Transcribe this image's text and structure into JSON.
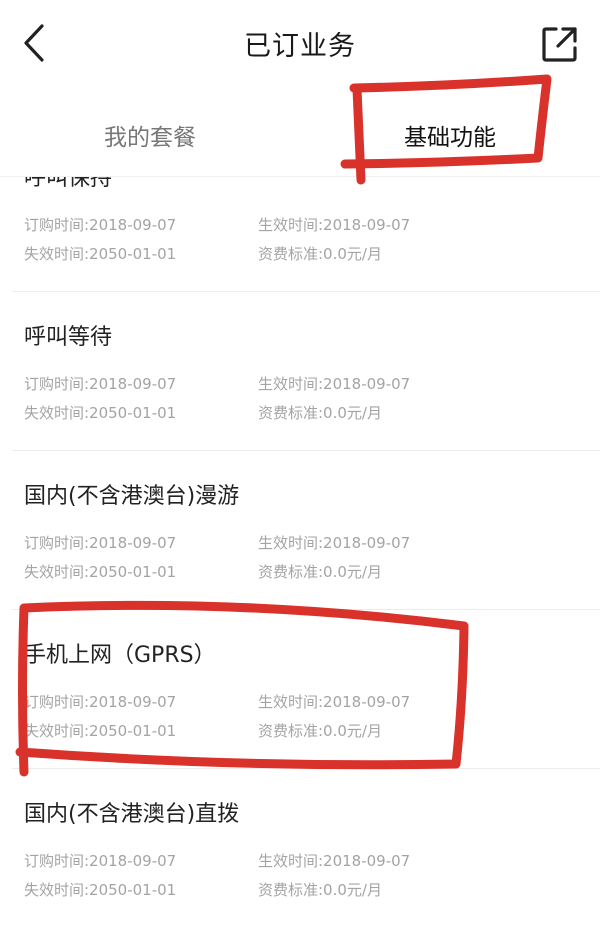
{
  "header": {
    "title": "已订业务",
    "back_icon": "chevron-left-icon",
    "share_icon": "external-link-icon"
  },
  "tabs": [
    {
      "label": "我的套餐",
      "active": false
    },
    {
      "label": "基础功能",
      "active": true
    }
  ],
  "labels": {
    "order_time": "订购时间:",
    "effective_time": "生效时间:",
    "expire_time": "失效时间:",
    "tariff": "资费标准:"
  },
  "services": [
    {
      "name": "呼叫保持",
      "order_time": "订购时间:2018-09-07",
      "effective_time": "生效时间:2018-09-07",
      "expire_time": "失效时间:2050-01-01",
      "tariff": "资费标准:0.0元/月"
    },
    {
      "name": "呼叫等待",
      "order_time": "订购时间:2018-09-07",
      "effective_time": "生效时间:2018-09-07",
      "expire_time": "失效时间:2050-01-01",
      "tariff": "资费标准:0.0元/月"
    },
    {
      "name": "国内(不含港澳台)漫游",
      "order_time": "订购时间:2018-09-07",
      "effective_time": "生效时间:2018-09-07",
      "expire_time": "失效时间:2050-01-01",
      "tariff": "资费标准:0.0元/月"
    },
    {
      "name": "手机上网（GPRS）",
      "order_time": "订购时间:2018-09-07",
      "effective_time": "生效时间:2018-09-07",
      "expire_time": "失效时间:2050-01-01",
      "tariff": "资费标准:0.0元/月"
    },
    {
      "name": "国内(不含港澳台)直拨",
      "order_time": "订购时间:2018-09-07",
      "effective_time": "生效时间:2018-09-07",
      "expire_time": "失效时间:2050-01-01",
      "tariff": "资费标准:0.0元/月"
    }
  ],
  "colors": {
    "annotation": "#d9322b",
    "text_primary": "#222222",
    "text_secondary": "#a4a4a4",
    "divider": "#ececec"
  }
}
